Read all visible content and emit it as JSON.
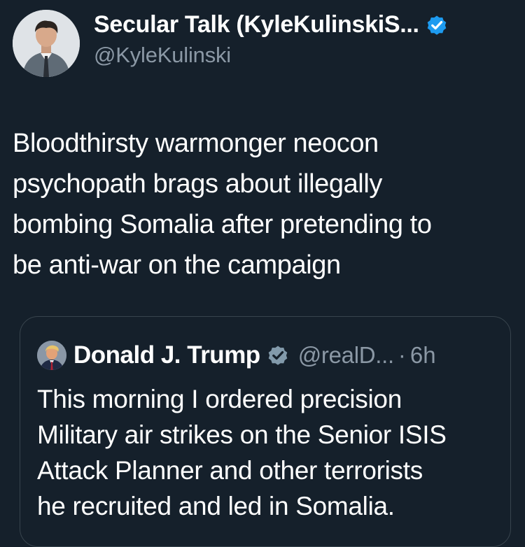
{
  "tweet": {
    "author": {
      "display_name": "Secular Talk (KyleKulinskiS...",
      "handle": "@KyleKulinski",
      "avatar_icon": "profile-photo-man-in-suit",
      "verified_icon": "verified-badge-icon"
    },
    "text_lines": [
      "Bloodthirsty warmonger neocon",
      "psychopath brags about illegally",
      "bombing Somalia after pretending to",
      "be anti-war on the campaign"
    ]
  },
  "quoted_tweet": {
    "author": {
      "display_name": "Donald J. Trump",
      "handle": "@realD...",
      "avatar_icon": "profile-photo-man",
      "verified_icon": "verified-badge-gray-icon"
    },
    "separator": "·",
    "time": "6h",
    "text_lines": [
      "This morning I ordered precision",
      "Military air strikes on the Senior ISIS",
      "Attack Planner and other terrorists",
      "he recruited and led in Somalia."
    ]
  },
  "colors": {
    "background": "#15202b",
    "text_primary": "#ffffff",
    "text_secondary": "#8b98a5",
    "verified_blue": "#1d9bf0",
    "verified_gray": "#829aab",
    "border": "#38444d"
  }
}
